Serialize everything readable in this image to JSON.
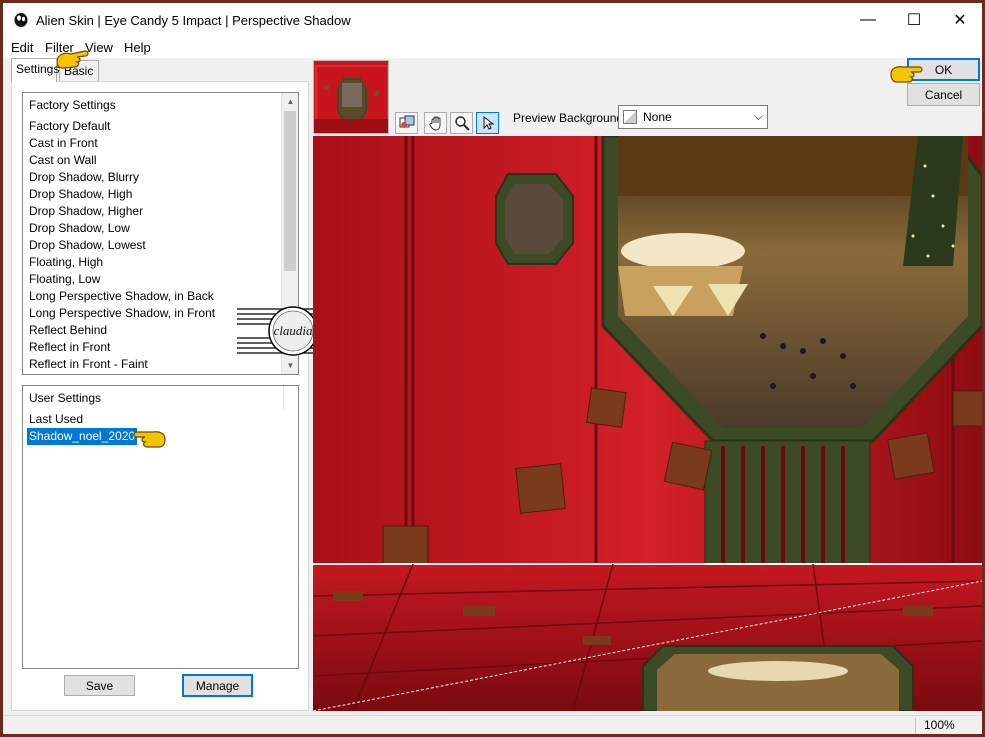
{
  "window": {
    "title": "Alien Skin | Eye Candy 5 Impact | Perspective Shadow",
    "controls": {
      "minimize": "—",
      "maximize": "☐",
      "close": "✕"
    }
  },
  "menu": {
    "items": [
      "Edit",
      "Filter",
      "View",
      "Help"
    ]
  },
  "tabs": {
    "items": [
      "Settings",
      "Basic"
    ],
    "active": "Settings"
  },
  "factory_settings": {
    "header": "Factory Settings",
    "items": [
      "Factory Default",
      "Cast in Front",
      "Cast on Wall",
      "Drop Shadow, Blurry",
      "Drop Shadow, High",
      "Drop Shadow, Higher",
      "Drop Shadow, Low",
      "Drop Shadow, Lowest",
      "Floating, High",
      "Floating, Low",
      "Long Perspective Shadow, in Back",
      "Long Perspective Shadow, in Front",
      "Reflect Behind",
      "Reflect in Front",
      "Reflect in Front - Faint"
    ]
  },
  "user_settings": {
    "header": "User Settings",
    "items": [
      "Last Used",
      "Shadow_noel_2020"
    ],
    "selected": "Shadow_noel_2020"
  },
  "buttons": {
    "save": "Save",
    "manage": "Manage",
    "ok": "OK",
    "cancel": "Cancel"
  },
  "preview_background": {
    "label": "Preview Background:",
    "value": "None",
    "arrow": "⌵"
  },
  "toolbar": {
    "icons": [
      "preview-toggle-icon",
      "hand-pan-icon",
      "zoom-icon",
      "arrow-select-icon"
    ]
  },
  "watermark": {
    "text": "claudia"
  },
  "status": {
    "zoom": "100%"
  },
  "colors": {
    "accent": "#0078d7",
    "preview_red": "#b01219",
    "window_border": "#6b2a1a",
    "pointer_yellow": "#f5c400"
  }
}
